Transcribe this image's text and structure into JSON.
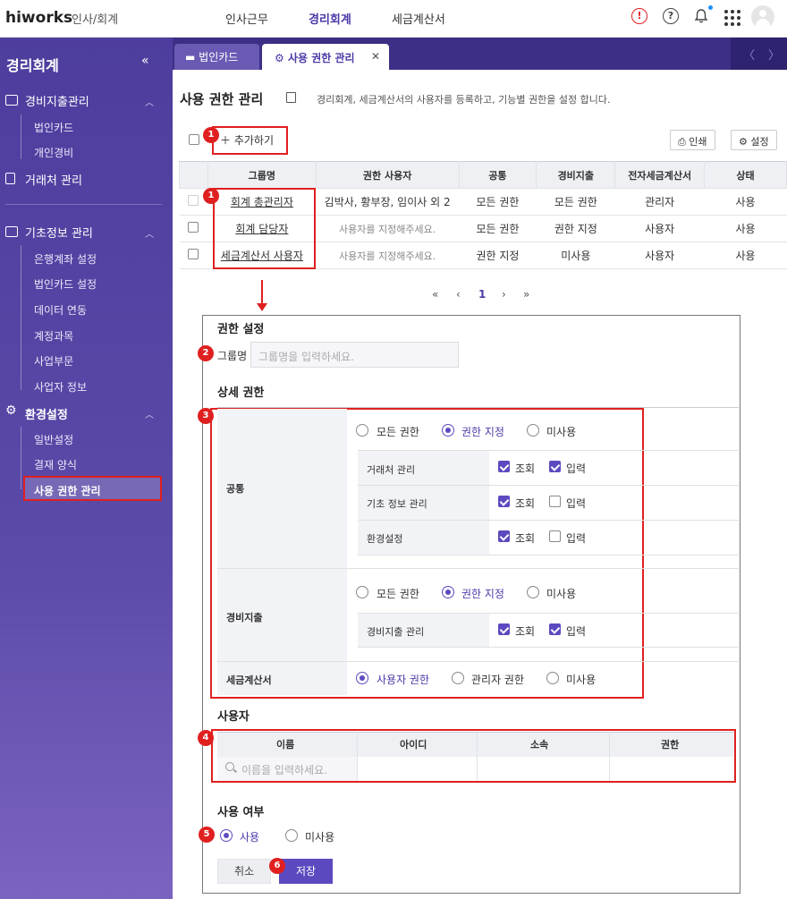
{
  "app": {
    "logo": "hiworks",
    "subtitle": "인사/회계"
  },
  "topnav": [
    "인사근무",
    "경리회계",
    "세금계산서"
  ],
  "sidebar": {
    "title": "경리회계",
    "groups": [
      {
        "label": "경비지출관리",
        "items": [
          "법인카드",
          "개인경비"
        ]
      },
      {
        "label": "거래처 관리",
        "items": []
      },
      {
        "label": "기초정보 관리",
        "items": [
          "은행계좌 설정",
          "법인카드 설정",
          "데이터 연동",
          "계정과목",
          "사업부문",
          "사업자 정보"
        ]
      },
      {
        "label": "환경설정",
        "items": [
          "일반설정",
          "결재 양식",
          "사용 권한 관리"
        ]
      }
    ]
  },
  "tabs": {
    "tab1": "법인카드",
    "tab2": "사용 권한 관리"
  },
  "page": {
    "title": "사용 권한 관리",
    "desc": "경리회계, 세금계산서의 사용자를 등록하고, 기능별 권한을 설정 합니다.",
    "add": "추가하기",
    "print": "인쇄",
    "settings": "설정"
  },
  "table": {
    "headers": [
      "그룹명",
      "권한 사용자",
      "공통",
      "경비지출",
      "전자세금계산서",
      "상태"
    ],
    "rows": [
      [
        "회계 총관리자",
        "김박사, 황부장, 임이사 외 2",
        "모든 권한",
        "모든 권한",
        "관리자",
        "사용"
      ],
      [
        "회계 담당자",
        "사용자를 지정해주세요.",
        "모든 권한",
        "권한 지정",
        "사용자",
        "사용"
      ],
      [
        "세금계산서 사용자",
        "사용자를 지정해주세요.",
        "권한 지정",
        "미사용",
        "사용자",
        "사용"
      ]
    ]
  },
  "pager": {
    "current": "1"
  },
  "badges": [
    "1",
    "1",
    "2",
    "3",
    "4",
    "5",
    "6"
  ],
  "detail": {
    "section_title": "권한 설정",
    "group_label": "그룹명",
    "group_placeholder": "그룹명을 입력하세요.",
    "detail_title": "상세 권한",
    "common_label": "공통",
    "expense_label": "경비지출",
    "tax_label": "세금계산서",
    "radio_all": "모든 권한",
    "radio_custom": "권한 지정",
    "radio_none": "미사용",
    "radio_user": "사용자 권한",
    "radio_admin": "관리자 권한",
    "common_rows": [
      "거래처 관리",
      "기초 정보 관리",
      "환경설정"
    ],
    "expense_rows": [
      "경비지출 관리"
    ],
    "view": "조회",
    "input": "입력",
    "user_title": "사용자",
    "user_headers": [
      "이름",
      "아이디",
      "소속",
      "권한"
    ],
    "user_placeholder": "이름을 입력하세요.",
    "use_title": "사용 여부",
    "use_on": "사용",
    "use_off": "미사용",
    "cancel": "취소",
    "save": "저장"
  }
}
